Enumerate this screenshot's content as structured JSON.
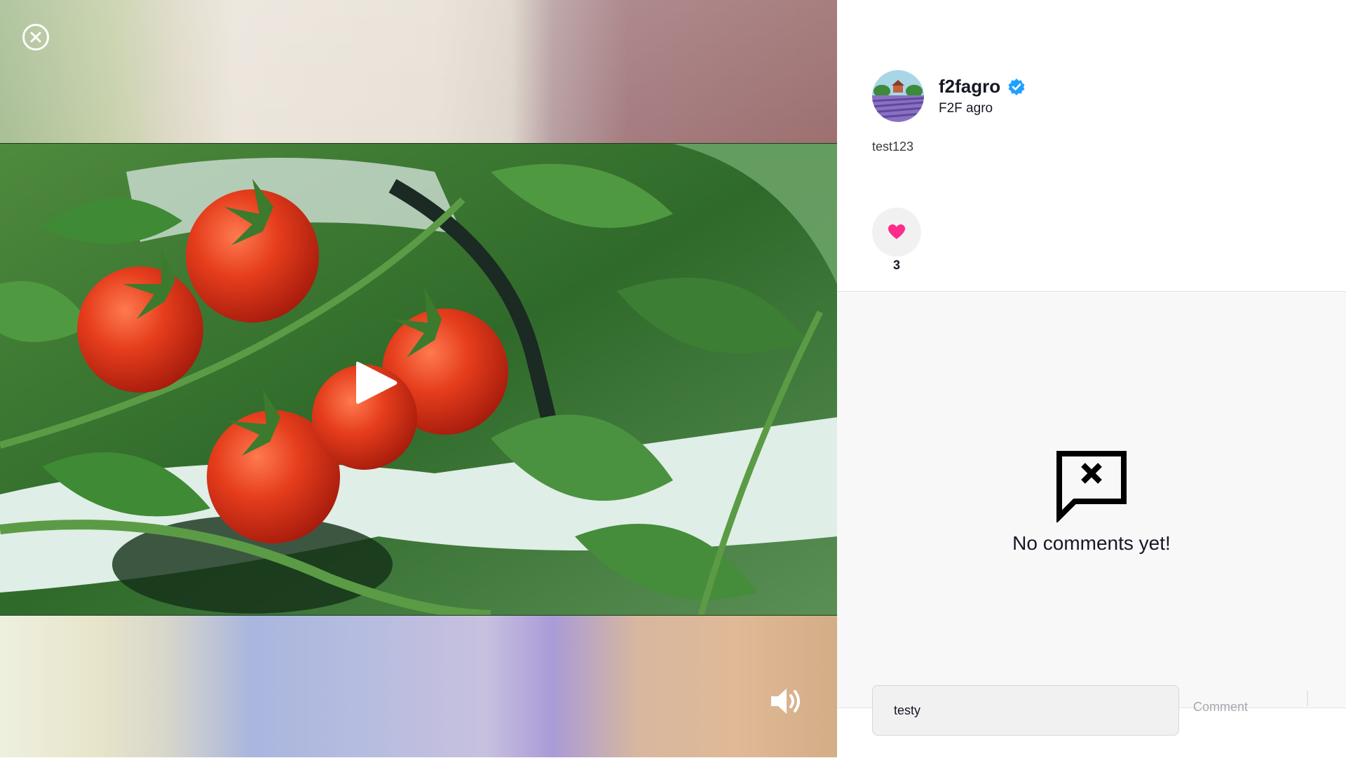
{
  "post": {
    "username": "f2fagro",
    "nickname": "F2F agro",
    "description": "test123",
    "like_count": "3"
  },
  "comments": {
    "empty_message": "No comments yet!",
    "input_value": "testy",
    "submit_label": "Comment"
  },
  "icons": {
    "close": "close-circle-icon",
    "play": "play-icon",
    "volume": "volume-icon",
    "verified": "verified-badge-icon",
    "like": "heart-icon",
    "no_comments": "comment-x-icon"
  },
  "colors": {
    "like": "#fe2c8a",
    "verified": "#20a0ff",
    "text": "#161823",
    "submit_disabled": "#a8a8b0"
  }
}
